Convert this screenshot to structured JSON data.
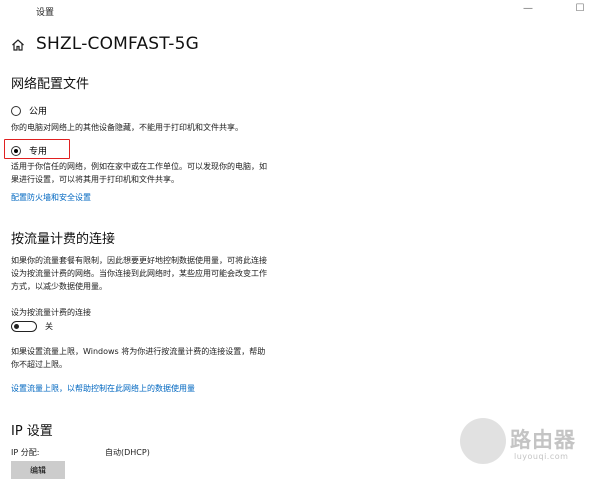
{
  "window": {
    "title": "设置",
    "minimize": "—",
    "maximize": "☐"
  },
  "page": {
    "title": "SHZL-COMFAST-5G"
  },
  "network_profile": {
    "heading": "网络配置文件",
    "public_label": "公用",
    "public_desc": "你的电脑对网络上的其他设备隐藏，不能用于打印机和文件共享。",
    "private_label": "专用",
    "private_desc_1": "适用于你信任的网络，例如在家中或在工作单位。可以发现你的电脑，如",
    "private_desc_2": "果进行设置，可以将其用于打印机和文件共享。",
    "selected": "专用",
    "firewall_link": "配置防火墙和安全设置"
  },
  "metered": {
    "heading": "按流量计费的连接",
    "desc_1": "如果你的流量套餐有限制，因此想要更好地控制数据使用量，可将此连接",
    "desc_2": "设为按流量计费的网络。当你连接到此网络时，某些应用可能会改变工作",
    "desc_3": "方式，以减少数据使用量。",
    "toggle_label": "设为按流量计费的连接",
    "toggle_state": "关",
    "limit_desc_1": "如果设置流量上限，Windows 将为你进行按流量计费的连接设置，帮助",
    "limit_desc_2": "你不超过上限。",
    "limit_link": "设置流量上限，以帮助控制在此网络上的数据使用量"
  },
  "ip": {
    "heading": "IP 设置",
    "assign_label": "IP 分配:",
    "assign_value": "自动(DHCP)",
    "edit_label": "编辑"
  },
  "watermark": {
    "text": "路由器",
    "sub": "luyouqi.com"
  }
}
